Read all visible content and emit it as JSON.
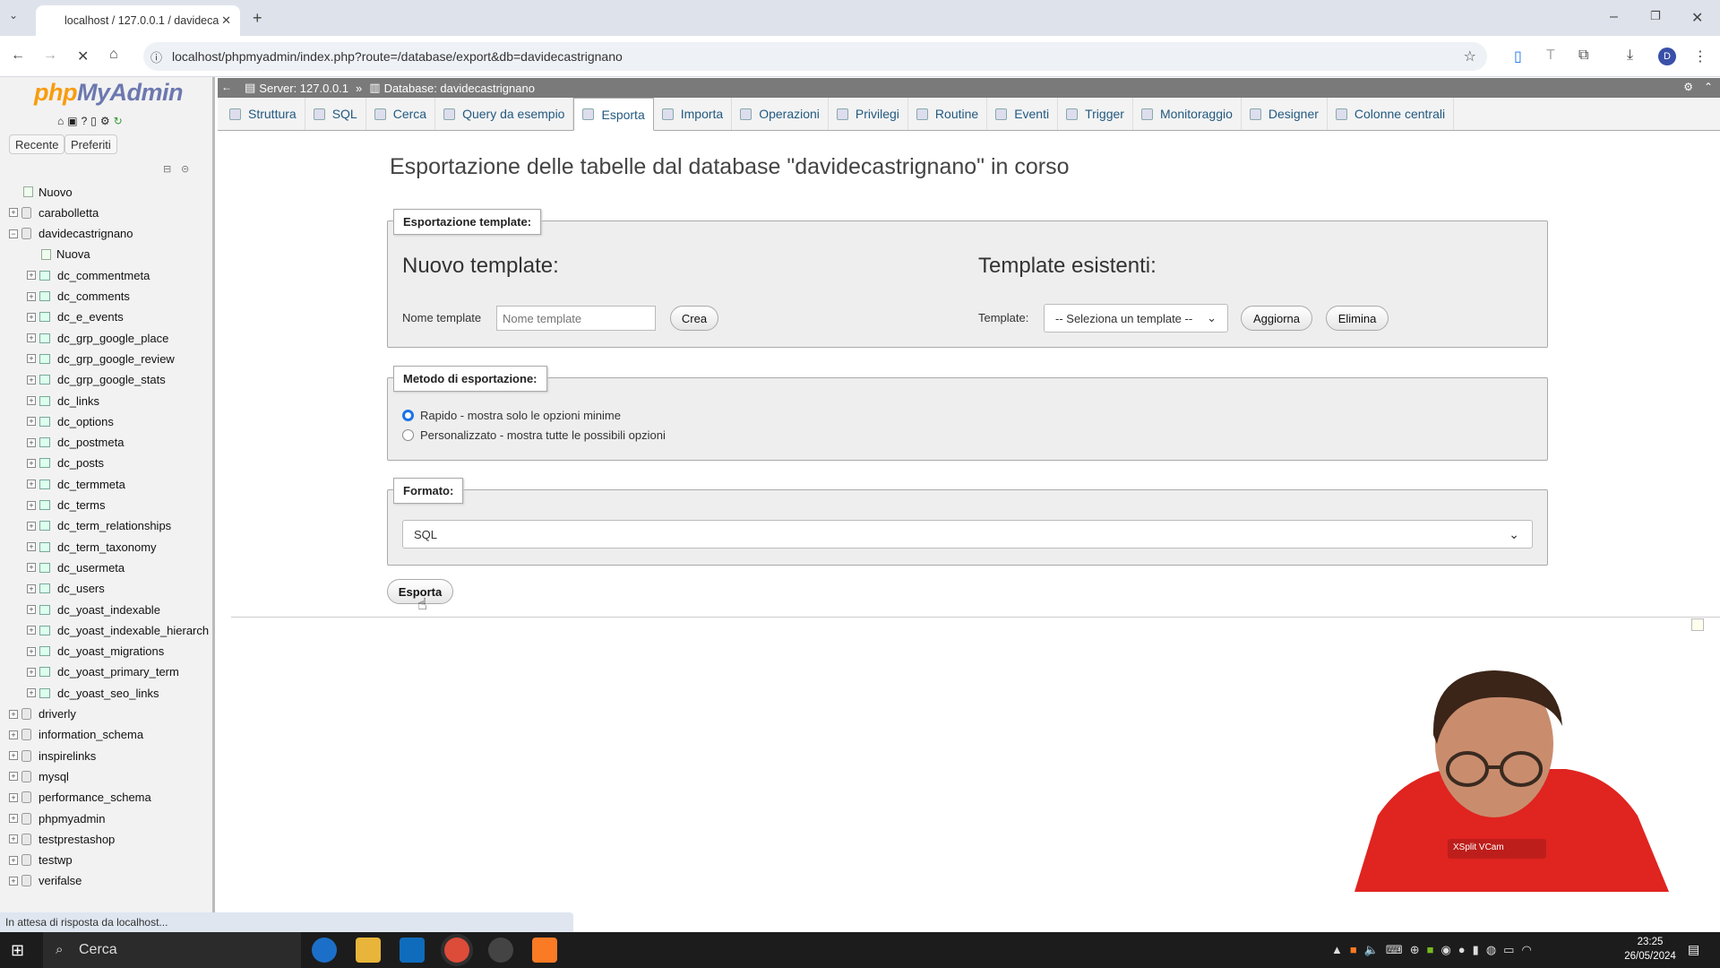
{
  "browser": {
    "tab_title": "localhost / 127.0.0.1 / davideca",
    "url": "localhost/phpmyadmin/index.php?route=/database/export&db=davidecastrignano",
    "profile_initial": "D"
  },
  "sidebar": {
    "logo_php": "php",
    "logo_myadmin": "MyAdmin",
    "recent_label": "Recente",
    "favorites_label": "Preferiti",
    "new_label": "Nuovo",
    "databases": [
      {
        "name": "carabolletta"
      },
      {
        "name": "davidecastrignano"
      }
    ],
    "new_table_label": "Nuova",
    "tables": [
      "dc_commentmeta",
      "dc_comments",
      "dc_e_events",
      "dc_grp_google_place",
      "dc_grp_google_review",
      "dc_grp_google_stats",
      "dc_links",
      "dc_options",
      "dc_postmeta",
      "dc_posts",
      "dc_termmeta",
      "dc_terms",
      "dc_term_relationships",
      "dc_term_taxonomy",
      "dc_usermeta",
      "dc_users",
      "dc_yoast_indexable",
      "dc_yoast_indexable_hierarch",
      "dc_yoast_migrations",
      "dc_yoast_primary_term",
      "dc_yoast_seo_links"
    ],
    "other_databases": [
      "driverly",
      "information_schema",
      "inspirelinks",
      "mysql",
      "performance_schema",
      "phpmyadmin",
      "testprestashop",
      "testwp",
      "verifalse"
    ]
  },
  "breadcrumb": {
    "server": "Server: 127.0.0.1",
    "separator": "»",
    "database": "Database: davidecastrignano"
  },
  "menu_tabs": [
    "Struttura",
    "SQL",
    "Cerca",
    "Query da esempio",
    "Esporta",
    "Importa",
    "Operazioni",
    "Privilegi",
    "Routine",
    "Eventi",
    "Trigger",
    "Monitoraggio",
    "Designer",
    "Colonne centrali"
  ],
  "active_tab": "Esporta",
  "page": {
    "title": "Esportazione delle tabelle dal database \"davidecastrignano\" in corso",
    "template_section": {
      "legend": "Esportazione template:",
      "new_heading": "Nuovo template:",
      "name_label": "Nome template",
      "name_placeholder": "Nome template",
      "create_button": "Crea",
      "existing_heading": "Template esistenti:",
      "template_label": "Template:",
      "template_select": "-- Seleziona un template --",
      "update_button": "Aggiorna",
      "delete_button": "Elimina"
    },
    "method_section": {
      "legend": "Metodo di esportazione:",
      "quick": "Rapido - mostra solo le opzioni minime",
      "custom": "Personalizzato - mostra tutte le possibili opzioni",
      "selected": "quick"
    },
    "format_section": {
      "legend": "Formato:",
      "value": "SQL"
    },
    "export_button": "Esporta"
  },
  "status_bar": "In attesa di risposta da localhost...",
  "webcam_label": "XSplit VCam",
  "taskbar": {
    "search_label": "Cerca",
    "time": "23:25",
    "date": "26/05/2024"
  }
}
